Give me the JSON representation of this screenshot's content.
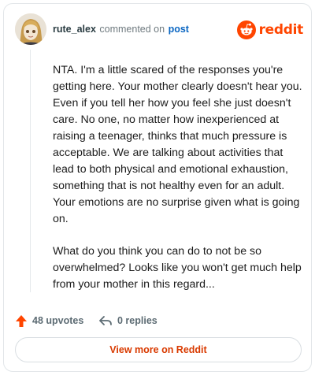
{
  "header": {
    "username": "rute_alex",
    "action_text": "commented on",
    "post_link": "post",
    "brand_name": "reddit",
    "brand_color": "#ff4500"
  },
  "comment": {
    "paragraphs": [
      "NTA. I'm a little scared of the responses you're getting here. Your mother clearly doesn't hear you. Even if you tell her how you feel she just doesn't care. No one, no matter how inexperienced at raising a teenager, thinks that much pressure is acceptable. We are talking about activities that lead to both physical and emotional exhaustion, something that is not healthy even for an adult. Your emotions are no surprise given what is going on.",
      "What do you think you can do to not be so overwhelmed? Looks like you won't get much help from your mother in this regard..."
    ]
  },
  "actions": {
    "upvotes_label": "48 upvotes",
    "replies_label": "0 replies",
    "upvote_icon": "upvote-arrow-icon",
    "reply_icon": "reply-arrow-icon"
  },
  "footer": {
    "view_more_label": "View more on Reddit",
    "accent_color": "#d93a00"
  }
}
